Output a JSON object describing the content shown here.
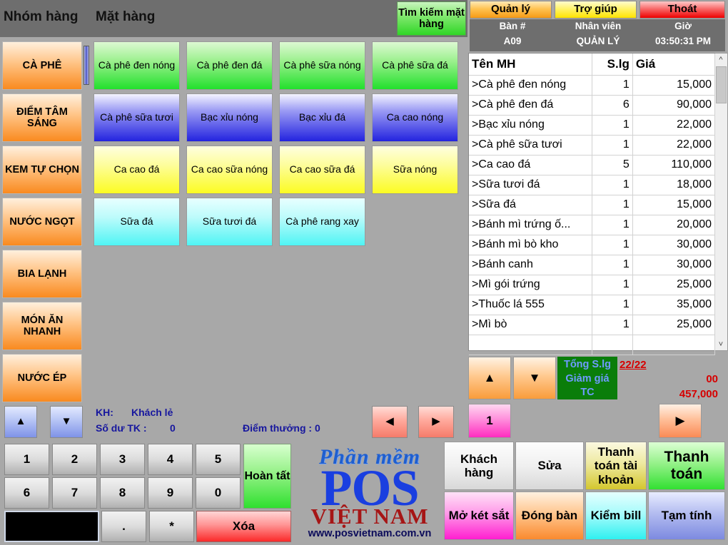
{
  "header": {
    "group_tab": "Nhóm hàng",
    "item_tab": "Mặt hàng",
    "search_button": "Tìm kiếm mặt hàng",
    "tabs": [
      {
        "label": "Quản lý"
      },
      {
        "label": "Trợ giúp"
      },
      {
        "label": "Thoát"
      }
    ],
    "info": {
      "table_label": "Bàn #",
      "table_value": "A09",
      "staff_label": "Nhân viên",
      "staff_value": "QUẢN LÝ",
      "time_label": "Giờ",
      "time_value": "03:50:31 PM"
    }
  },
  "categories": [
    {
      "label": "CÀ PHÊ",
      "selected": true
    },
    {
      "label": "ĐIỂM TÂM SÁNG",
      "selected": false
    },
    {
      "label": "KEM TỰ CHỌN",
      "selected": false
    },
    {
      "label": "NƯỚC NGỌT",
      "selected": false
    },
    {
      "label": "BIA LẠNH",
      "selected": false
    },
    {
      "label": "MÓN ĂN NHANH",
      "selected": false
    },
    {
      "label": "NƯỚC ÉP",
      "selected": false
    }
  ],
  "products": [
    {
      "label": "Cà phê đen nóng",
      "color": "green"
    },
    {
      "label": "Cà phê đen đá",
      "color": "green"
    },
    {
      "label": "Cà phê sữa nóng",
      "color": "green"
    },
    {
      "label": "Cà phê sữa đá",
      "color": "green"
    },
    {
      "label": "Cà phê sữa tươi",
      "color": "blue"
    },
    {
      "label": "Bạc xỉu nóng",
      "color": "blue"
    },
    {
      "label": "Bạc xỉu đá",
      "color": "blue"
    },
    {
      "label": "Ca cao nóng",
      "color": "blue"
    },
    {
      "label": "Ca cao đá",
      "color": "yellow"
    },
    {
      "label": "Ca cao sữa nóng",
      "color": "yellow"
    },
    {
      "label": "Ca cao sữa đá",
      "color": "yellow"
    },
    {
      "label": "Sữa nóng",
      "color": "yellow"
    },
    {
      "label": "Sữa đá",
      "color": "cyan"
    },
    {
      "label": "Sữa tươi đá",
      "color": "cyan"
    },
    {
      "label": "Cà phê rang xay",
      "color": "cyan"
    }
  ],
  "order": {
    "columns": [
      "Tên MH",
      "S.lg",
      "Giá"
    ],
    "rows": [
      {
        "name": ">Cà phê đen nóng",
        "qty": "1",
        "price": "15,000"
      },
      {
        "name": ">Cà phê đen đá",
        "qty": "6",
        "price": "90,000"
      },
      {
        "name": ">Bạc xỉu nóng",
        "qty": "1",
        "price": "22,000"
      },
      {
        "name": ">Cà phê sữa tươi",
        "qty": "1",
        "price": "22,000"
      },
      {
        "name": ">Ca cao đá",
        "qty": "5",
        "price": "110,000"
      },
      {
        "name": ">Sữa tươi đá",
        "qty": "1",
        "price": "18,000"
      },
      {
        "name": ">Sữa đá",
        "qty": "1",
        "price": "15,000"
      },
      {
        "name": ">Bánh mì trứng ố...",
        "qty": "1",
        "price": "20,000"
      },
      {
        "name": ">Bánh mì bò kho",
        "qty": "1",
        "price": "30,000"
      },
      {
        "name": ">Bánh canh",
        "qty": "1",
        "price": "30,000"
      },
      {
        "name": ">Mì gói trứng",
        "qty": "1",
        "price": "25,000"
      },
      {
        "name": ">Thuốc lá 555",
        "qty": "1",
        "price": "35,000"
      },
      {
        "name": ">Mì bò",
        "qty": "1",
        "price": "25,000"
      }
    ]
  },
  "totals": {
    "qty_label": "Tổng S.lg",
    "qty_value": "22/22",
    "discount_label": "Giảm giá",
    "discount_value": "00",
    "tc_label": "TC",
    "tc_value": "457,000"
  },
  "nav": {
    "up_arrow": "▲",
    "down_arrow": "▼",
    "left_arrow": "◀",
    "right_arrow": "▶",
    "page_current": "1"
  },
  "customer": {
    "kh_label": "KH:",
    "kh_value": "Khách lẻ",
    "balance_label": "Số dư TK :",
    "balance_value": "0",
    "points": "Điểm thưởng : 0"
  },
  "numpad": {
    "keys": [
      "1",
      "2",
      "3",
      "4",
      "5",
      "6",
      "7",
      "8",
      "9",
      "0",
      ".",
      "*"
    ],
    "done": "Hoàn tất",
    "clear": "Xóa",
    "display_value": ""
  },
  "logo": {
    "line1": "Phần mềm",
    "line2": "POS",
    "line3": "VIỆT NAM",
    "line4": "www.posvietnam.com.vn"
  },
  "actions": [
    {
      "label": "Khách hàng",
      "style": "white"
    },
    {
      "label": "Sửa",
      "style": "white"
    },
    {
      "label": "Thanh toán tài khoản",
      "style": "khaki"
    },
    {
      "label": "Thanh toán",
      "style": "green"
    },
    {
      "label": "Mở két sắt",
      "style": "magenta"
    },
    {
      "label": "Đóng bàn",
      "style": "orange"
    },
    {
      "label": "Kiểm bill",
      "style": "cyan"
    },
    {
      "label": "Tạm tính",
      "style": "blue"
    }
  ],
  "colors": {
    "background": "#a8a8a8",
    "topbar": "#6e6e6e",
    "total_panel": "#0a7d0a",
    "total_text": "#d60000",
    "customer_text": "#17179e"
  }
}
